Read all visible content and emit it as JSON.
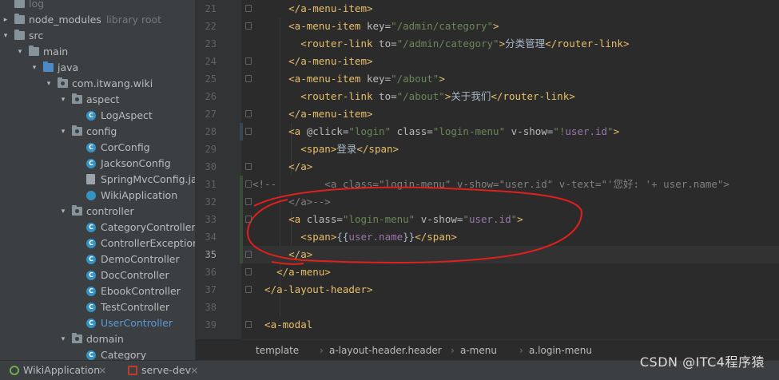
{
  "project_tree": [
    {
      "label": "log",
      "suffix": "",
      "icon": "folder-icon",
      "indent": 0,
      "arrow": "",
      "style": "dim"
    },
    {
      "label": "node_modules",
      "suffix": "library root",
      "icon": "folder-icon",
      "indent": 0,
      "arrow": "▸",
      "style": ""
    },
    {
      "label": "src",
      "suffix": "",
      "icon": "folder-icon",
      "indent": 0,
      "arrow": "▾",
      "style": ""
    },
    {
      "label": "main",
      "suffix": "",
      "icon": "folder-icon",
      "indent": 1,
      "arrow": "▾",
      "style": ""
    },
    {
      "label": "java",
      "suffix": "",
      "icon": "source-folder-icon",
      "indent": 2,
      "arrow": "▾",
      "style": ""
    },
    {
      "label": "com.itwang.wiki",
      "suffix": "",
      "icon": "package-icon",
      "indent": 3,
      "arrow": "▾",
      "style": ""
    },
    {
      "label": "aspect",
      "suffix": "",
      "icon": "package-icon",
      "indent": 4,
      "arrow": "▾",
      "style": ""
    },
    {
      "label": "LogAspect",
      "suffix": "",
      "icon": "class-icon",
      "indent": 5,
      "arrow": "",
      "style": ""
    },
    {
      "label": "config",
      "suffix": "",
      "icon": "package-icon",
      "indent": 4,
      "arrow": "▾",
      "style": ""
    },
    {
      "label": "CorConfig",
      "suffix": "",
      "icon": "class-icon",
      "indent": 5,
      "arrow": "",
      "style": ""
    },
    {
      "label": "JacksonConfig",
      "suffix": "",
      "icon": "class-icon",
      "indent": 5,
      "arrow": "",
      "style": ""
    },
    {
      "label": "SpringMvcConfig.java",
      "suffix": "",
      "icon": "java-file-icon",
      "indent": 5,
      "arrow": "",
      "style": ""
    },
    {
      "label": "WikiApplication",
      "suffix": "",
      "icon": "app-class-icon",
      "indent": 5,
      "arrow": "",
      "style": ""
    },
    {
      "label": "controller",
      "suffix": "",
      "icon": "package-icon",
      "indent": 4,
      "arrow": "▾",
      "style": ""
    },
    {
      "label": "CategoryController",
      "suffix": "",
      "icon": "class-icon",
      "indent": 5,
      "arrow": "",
      "style": ""
    },
    {
      "label": "ControllerExceptionHar",
      "suffix": "",
      "icon": "class-icon",
      "indent": 5,
      "arrow": "",
      "style": ""
    },
    {
      "label": "DemoController",
      "suffix": "",
      "icon": "class-icon",
      "indent": 5,
      "arrow": "",
      "style": ""
    },
    {
      "label": "DocController",
      "suffix": "",
      "icon": "class-icon",
      "indent": 5,
      "arrow": "",
      "style": ""
    },
    {
      "label": "EbookController",
      "suffix": "",
      "icon": "class-icon",
      "indent": 5,
      "arrow": "",
      "style": ""
    },
    {
      "label": "TestController",
      "suffix": "",
      "icon": "class-icon",
      "indent": 5,
      "arrow": "",
      "style": ""
    },
    {
      "label": "UserController",
      "suffix": "",
      "icon": "class-icon",
      "indent": 5,
      "arrow": "",
      "style": "link"
    },
    {
      "label": "domain",
      "suffix": "",
      "icon": "package-icon",
      "indent": 4,
      "arrow": "▾",
      "style": ""
    },
    {
      "label": "Category",
      "suffix": "",
      "icon": "class-icon",
      "indent": 5,
      "arrow": "",
      "style": ""
    }
  ],
  "gutter_lines": [
    21,
    22,
    23,
    24,
    25,
    26,
    27,
    28,
    29,
    30,
    31,
    32,
    33,
    34,
    35,
    36,
    37,
    38,
    39
  ],
  "current_line": 35,
  "code_lines": [
    [
      {
        "c": "t",
        "s": "      </a-menu-item>"
      }
    ],
    [
      {
        "c": "t",
        "s": "      <a-menu-item "
      },
      {
        "c": "a",
        "s": "key="
      },
      {
        "c": "v",
        "s": "\"/admin/category\""
      },
      {
        "c": "t",
        "s": ">"
      }
    ],
    [
      {
        "c": "t",
        "s": "        <router-link "
      },
      {
        "c": "a",
        "s": "to="
      },
      {
        "c": "v",
        "s": "\"/admin/category\""
      },
      {
        "c": "t",
        "s": ">"
      },
      {
        "c": "txt",
        "s": "分类管理"
      },
      {
        "c": "t",
        "s": "</router-link>"
      }
    ],
    [
      {
        "c": "t",
        "s": "      </a-menu-item>"
      }
    ],
    [
      {
        "c": "t",
        "s": "      <a-menu-item "
      },
      {
        "c": "a",
        "s": "key="
      },
      {
        "c": "v",
        "s": "\"/about\""
      },
      {
        "c": "t",
        "s": ">"
      }
    ],
    [
      {
        "c": "t",
        "s": "        <router-link "
      },
      {
        "c": "a",
        "s": "to="
      },
      {
        "c": "v",
        "s": "\"/about\""
      },
      {
        "c": "t",
        "s": ">"
      },
      {
        "c": "txt",
        "s": "关于我们"
      },
      {
        "c": "t",
        "s": "</router-link>"
      }
    ],
    [
      {
        "c": "t",
        "s": "      </a-menu-item>"
      }
    ],
    [
      {
        "c": "t",
        "s": "      <a "
      },
      {
        "c": "a",
        "s": "@click="
      },
      {
        "c": "v",
        "s": "\"login\" "
      },
      {
        "c": "a",
        "s": "class="
      },
      {
        "c": "v",
        "s": "\"login-menu\" "
      },
      {
        "c": "a",
        "s": "v-show="
      },
      {
        "c": "v",
        "s": "\"!"
      },
      {
        "c": "vp",
        "s": "user.id"
      },
      {
        "c": "v",
        "s": "\""
      },
      {
        "c": "t",
        "s": ">"
      }
    ],
    [
      {
        "c": "t",
        "s": "        <span>"
      },
      {
        "c": "txt",
        "s": "登录"
      },
      {
        "c": "t",
        "s": "</span>"
      }
    ],
    [
      {
        "c": "t",
        "s": "      </a>"
      }
    ],
    [
      {
        "c": "cm",
        "s": "<!--        <a class=\"login-menu\" v-show=\"user.id\" v-text=\"'您好: '+ user.name\">"
      }
    ],
    [
      {
        "c": "cm",
        "s": "      </a>-->"
      }
    ],
    [
      {
        "c": "t",
        "s": "      <a "
      },
      {
        "c": "a",
        "s": "class="
      },
      {
        "c": "v",
        "s": "\"login-menu\" "
      },
      {
        "c": "a",
        "s": "v-show="
      },
      {
        "c": "v",
        "s": "\""
      },
      {
        "c": "vp",
        "s": "user.id"
      },
      {
        "c": "v",
        "s": "\""
      },
      {
        "c": "t",
        "s": ">"
      }
    ],
    [
      {
        "c": "t",
        "s": "        <span>"
      },
      {
        "c": "txt",
        "s": "{{"
      },
      {
        "c": "vp",
        "s": "user.name"
      },
      {
        "c": "txt",
        "s": "}}"
      },
      {
        "c": "t",
        "s": "</span>"
      }
    ],
    [
      {
        "c": "t",
        "s": "      </a>"
      }
    ],
    [
      {
        "c": "t",
        "s": "    </a-menu>"
      }
    ],
    [
      {
        "c": "t",
        "s": "  </a-layout-header>"
      }
    ],
    [
      {
        "c": "t",
        "s": ""
      }
    ],
    [
      {
        "c": "t",
        "s": "  <a-modal"
      }
    ]
  ],
  "breadcrumb": [
    "template",
    "a-layout-header.header",
    "a-menu",
    "a.login-menu"
  ],
  "status_tabs": [
    {
      "label": "WikiApplication",
      "icon": "spring-boot-icon",
      "close": "×"
    },
    {
      "label": "serve-dev",
      "icon": "npm-icon",
      "close": "×"
    }
  ],
  "watermark": "CSDN @ITC4程序猿",
  "colors": {
    "tag": "#e8bf6a",
    "attr": "#bababa",
    "string": "#6a8759",
    "comment": "#808080",
    "annotation": "#ff0000"
  }
}
